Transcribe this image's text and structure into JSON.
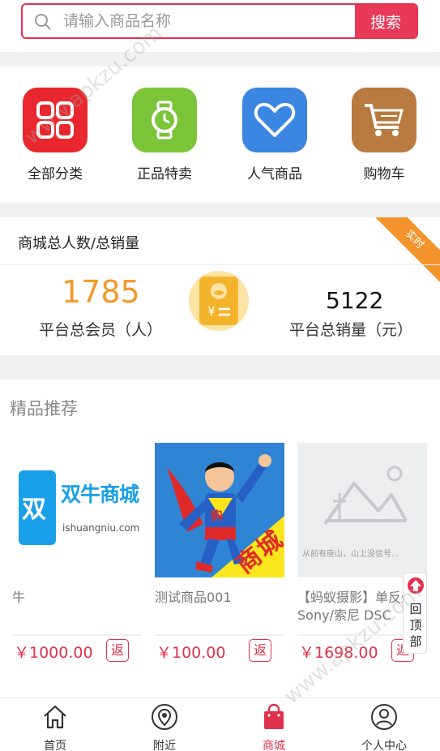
{
  "search": {
    "placeholder": "请输入商品名称",
    "button_label": "搜索"
  },
  "categories": [
    {
      "label": "全部分类",
      "icon": "grid-icon",
      "color": "#e8282e"
    },
    {
      "label": "正品特卖",
      "icon": "watch-icon",
      "color": "#7cc43a"
    },
    {
      "label": "人气商品",
      "icon": "heart-icon",
      "color": "#3a86e0"
    },
    {
      "label": "购物车",
      "icon": "cart-icon",
      "color": "#b87a3e"
    }
  ],
  "stats": {
    "title": "商城总人数/总销量",
    "badge": "实时",
    "members_value": "1785",
    "members_label": "平台总会员（人）",
    "sales_value": "5122",
    "sales_label": "平台总销量（元）"
  },
  "recommend": {
    "title": "精品推荐",
    "products": [
      {
        "image_brand": "双牛商城",
        "image_domain": "ishuangniu.com",
        "name": "牛",
        "price": "￥1000.00",
        "return_label": "返"
      },
      {
        "image_badge": "购",
        "image_banner": "商城",
        "name": "测试商品001",
        "price": "￥100.00",
        "return_label": "返"
      },
      {
        "image_caption": "从前有座山，山上没信号...",
        "name": "【蚂蚁摄影】单反外观Sony/索尼 DSC",
        "price": "￥1698.00",
        "return_label": "返"
      }
    ]
  },
  "back_to_top": {
    "label": "回顶部"
  },
  "nav": [
    {
      "label": "首页",
      "icon": "home-icon"
    },
    {
      "label": "附近",
      "icon": "location-icon"
    },
    {
      "label": "商城",
      "icon": "shopping-bag-icon",
      "active": true
    },
    {
      "label": "个人中心",
      "icon": "user-icon"
    }
  ],
  "watermark": "www.apkzu.com",
  "colors": {
    "accent": "#e83a58",
    "orange": "#f29a2c"
  }
}
